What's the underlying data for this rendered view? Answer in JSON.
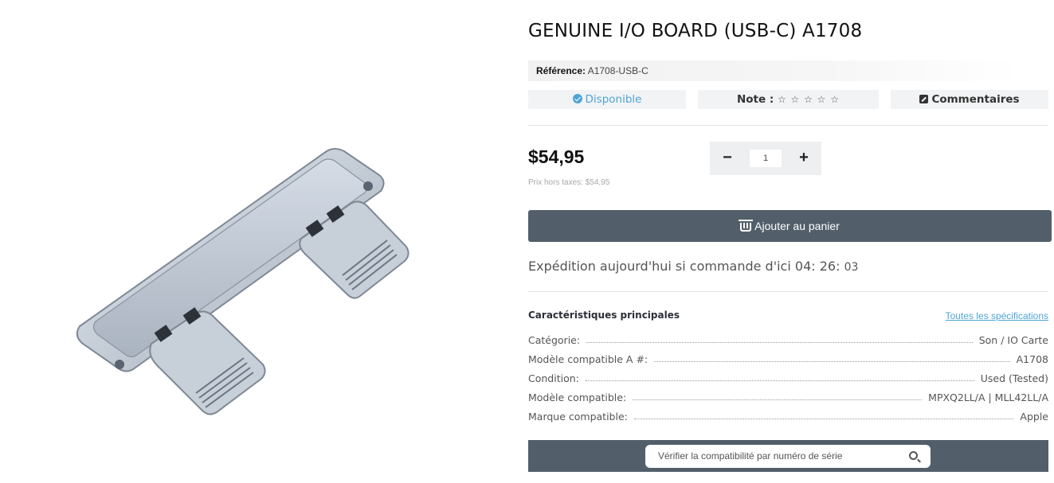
{
  "product": {
    "title": "GENUINE I/O BOARD (USB-C) A1708",
    "reference_label": "Référence:",
    "reference_value": "A1708-USB-C"
  },
  "status": {
    "availability": "Disponible",
    "rating_label": "Note :",
    "rating_stars": "☆ ☆ ☆ ☆ ☆",
    "comments_label": "Commentaires"
  },
  "pricing": {
    "price": "$54,95",
    "price_excl_tax": "Prix hors taxes: $54,95"
  },
  "quantity": {
    "minus": "−",
    "value": "1",
    "plus": "+"
  },
  "cart": {
    "add_label": "Ajouter au panier"
  },
  "shipping": {
    "text": "Expédition aujourd'hui si commande d'ici",
    "hours": "04",
    "minutes": "26",
    "seconds": "03"
  },
  "specs": {
    "title": "Caractéristiques principales",
    "all_link": "Toutes les spécifications",
    "rows": [
      {
        "label": "Catégorie:",
        "value": "Son / IO Carte"
      },
      {
        "label": "Modèle compatible A #:",
        "value": "A1708"
      },
      {
        "label": "Condition:",
        "value": "Used (Tested)"
      },
      {
        "label": "Modèle compatible:",
        "value": "MPXQ2LL/A | MLL42LL/A"
      },
      {
        "label": "Marque compatible:",
        "value": "Apple"
      }
    ]
  },
  "serial_check": {
    "placeholder": "Vérifier la compatibilité par numéro de série"
  },
  "icons": {
    "availability": "check-circle-icon",
    "comments": "edit-icon",
    "cart": "basket-icon",
    "serial": "search-icon"
  },
  "colors": {
    "accent": "#4fa5d6",
    "button_dark": "#525f6b",
    "pill_bg": "#f2f3f5"
  }
}
